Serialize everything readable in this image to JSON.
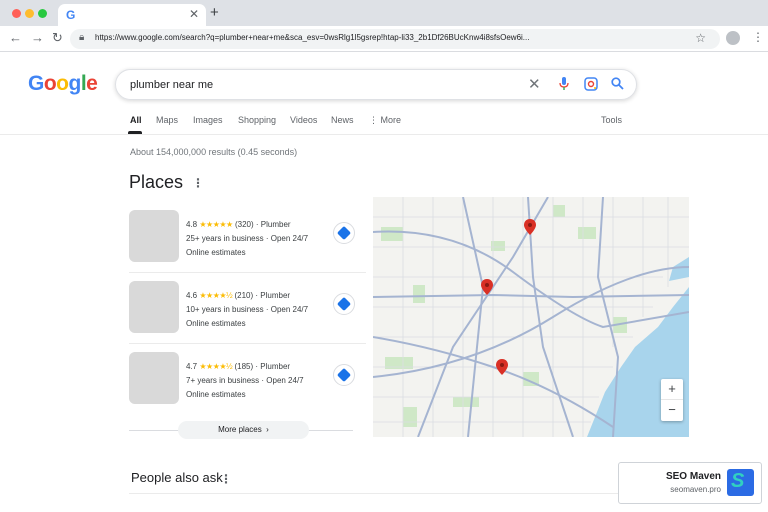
{
  "browser": {
    "tab_logo": "G",
    "address": "https://www.google.com/search?q=plumber+near+me&sca_esv=0wsRlg1l5gsrep!htap-li33_2b1Df26BUcKnw4i8sfsOew6i..."
  },
  "google": {
    "logo_letters": [
      "G",
      "o",
      "o",
      "g",
      "l",
      "e"
    ],
    "logo_colors": [
      "#4285f4",
      "#ea4335",
      "#fbbc05",
      "#4285f4",
      "#34a853",
      "#ea4335"
    ],
    "query": "plumber near me"
  },
  "nav_tabs": [
    "All",
    "Maps",
    "Images",
    "Shopping",
    "Videos",
    "News",
    "More"
  ],
  "tools_label": "Tools",
  "result_stats": "About 154,000,000 results (0.45 seconds)",
  "places": {
    "title": "Places",
    "items": [
      {
        "rating": "4.8",
        "stars": "★★★★★",
        "reviews": "(320)",
        "category": "Plumber",
        "years": "25+ years in business",
        "hours": "Open 24/7",
        "note": "Online estimates"
      },
      {
        "rating": "4.6",
        "stars": "★★★★½",
        "reviews": "(210)",
        "category": "Plumber",
        "years": "10+ years in business",
        "hours": "Open 24/7",
        "note": "Online estimates"
      },
      {
        "rating": "4.7",
        "stars": "★★★★½",
        "reviews": "(185)",
        "category": "Plumber",
        "years": "7+ years in business",
        "hours": "Open 24/7",
        "note": "Online estimates"
      }
    ],
    "more_label": "More places",
    "map_pin_count": 3
  },
  "zoom": {
    "in": "+",
    "out": "−"
  },
  "people_also_ask": "People also ask",
  "watermark": {
    "name": "SEO Maven",
    "site": "seomaven.pro"
  },
  "colors": {
    "accent": "#1a73e8",
    "pin": "#d93025",
    "star": "#fbbc04"
  }
}
